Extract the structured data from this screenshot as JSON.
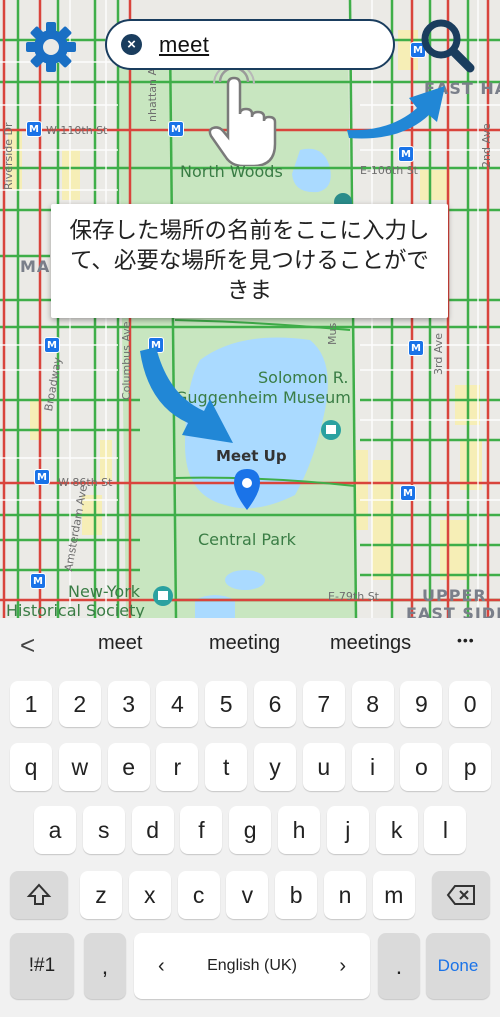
{
  "search": {
    "value": "meet",
    "clear_icon": "close-icon"
  },
  "map": {
    "labels": {
      "north_woods": "North Woods",
      "solomon_1": "Solomon R.",
      "solomon_2": "Guggenheim Museum",
      "meet_up": "Meet Up",
      "central_park": "Central Park",
      "nyhs_1": "New-York",
      "nyhs_2": "Historical Society",
      "east_harlem": "EAST HA",
      "upper_east_1": "UPPER",
      "upper_east_2": "EAST SIDE",
      "manhattan_partial": "MA"
    },
    "streets": {
      "w110": "W-110th St",
      "w86": "W-86th St",
      "e106": "E-106th St",
      "e79": "E-79th St",
      "riverside": "Riverside Dr",
      "broadway": "Broadway",
      "columbus": "Columbus Ave",
      "amsterdam": "Amsterdam Ave",
      "manhattan_ave": "nhattan Ave",
      "madison": "Mus",
      "second_ave": "2nd Ave",
      "third_ave": "3rd Ave"
    },
    "metro_label": "M",
    "colors": {
      "park": "#c8e6c0",
      "water": "#aadaff",
      "road_green": "#3fae49",
      "road_red": "#d9443c",
      "pin": "#1a73e8"
    }
  },
  "tooltip": {
    "text": "保存した場所の名前をここに入力して、必要な場所を見つけることができま"
  },
  "keyboard": {
    "suggestions": {
      "back": "<",
      "s1": "meet",
      "s2": "meeting",
      "s3": "meetings",
      "more": "•••"
    },
    "row_numbers": [
      "1",
      "2",
      "3",
      "4",
      "5",
      "6",
      "7",
      "8",
      "9",
      "0"
    ],
    "row_top": [
      "q",
      "w",
      "e",
      "r",
      "t",
      "y",
      "u",
      "i",
      "o",
      "p"
    ],
    "row_mid": [
      "a",
      "s",
      "d",
      "f",
      "g",
      "h",
      "j",
      "k",
      "l"
    ],
    "row_bottom": [
      "z",
      "x",
      "c",
      "v",
      "b",
      "n",
      "m"
    ],
    "shift_icon": "shift-icon",
    "backspace_icon": "backspace-icon",
    "symbols": "!#1",
    "comma": ",",
    "space_left": "‹",
    "space_label": "English (UK)",
    "space_right": "›",
    "period": ".",
    "done": "Done"
  }
}
